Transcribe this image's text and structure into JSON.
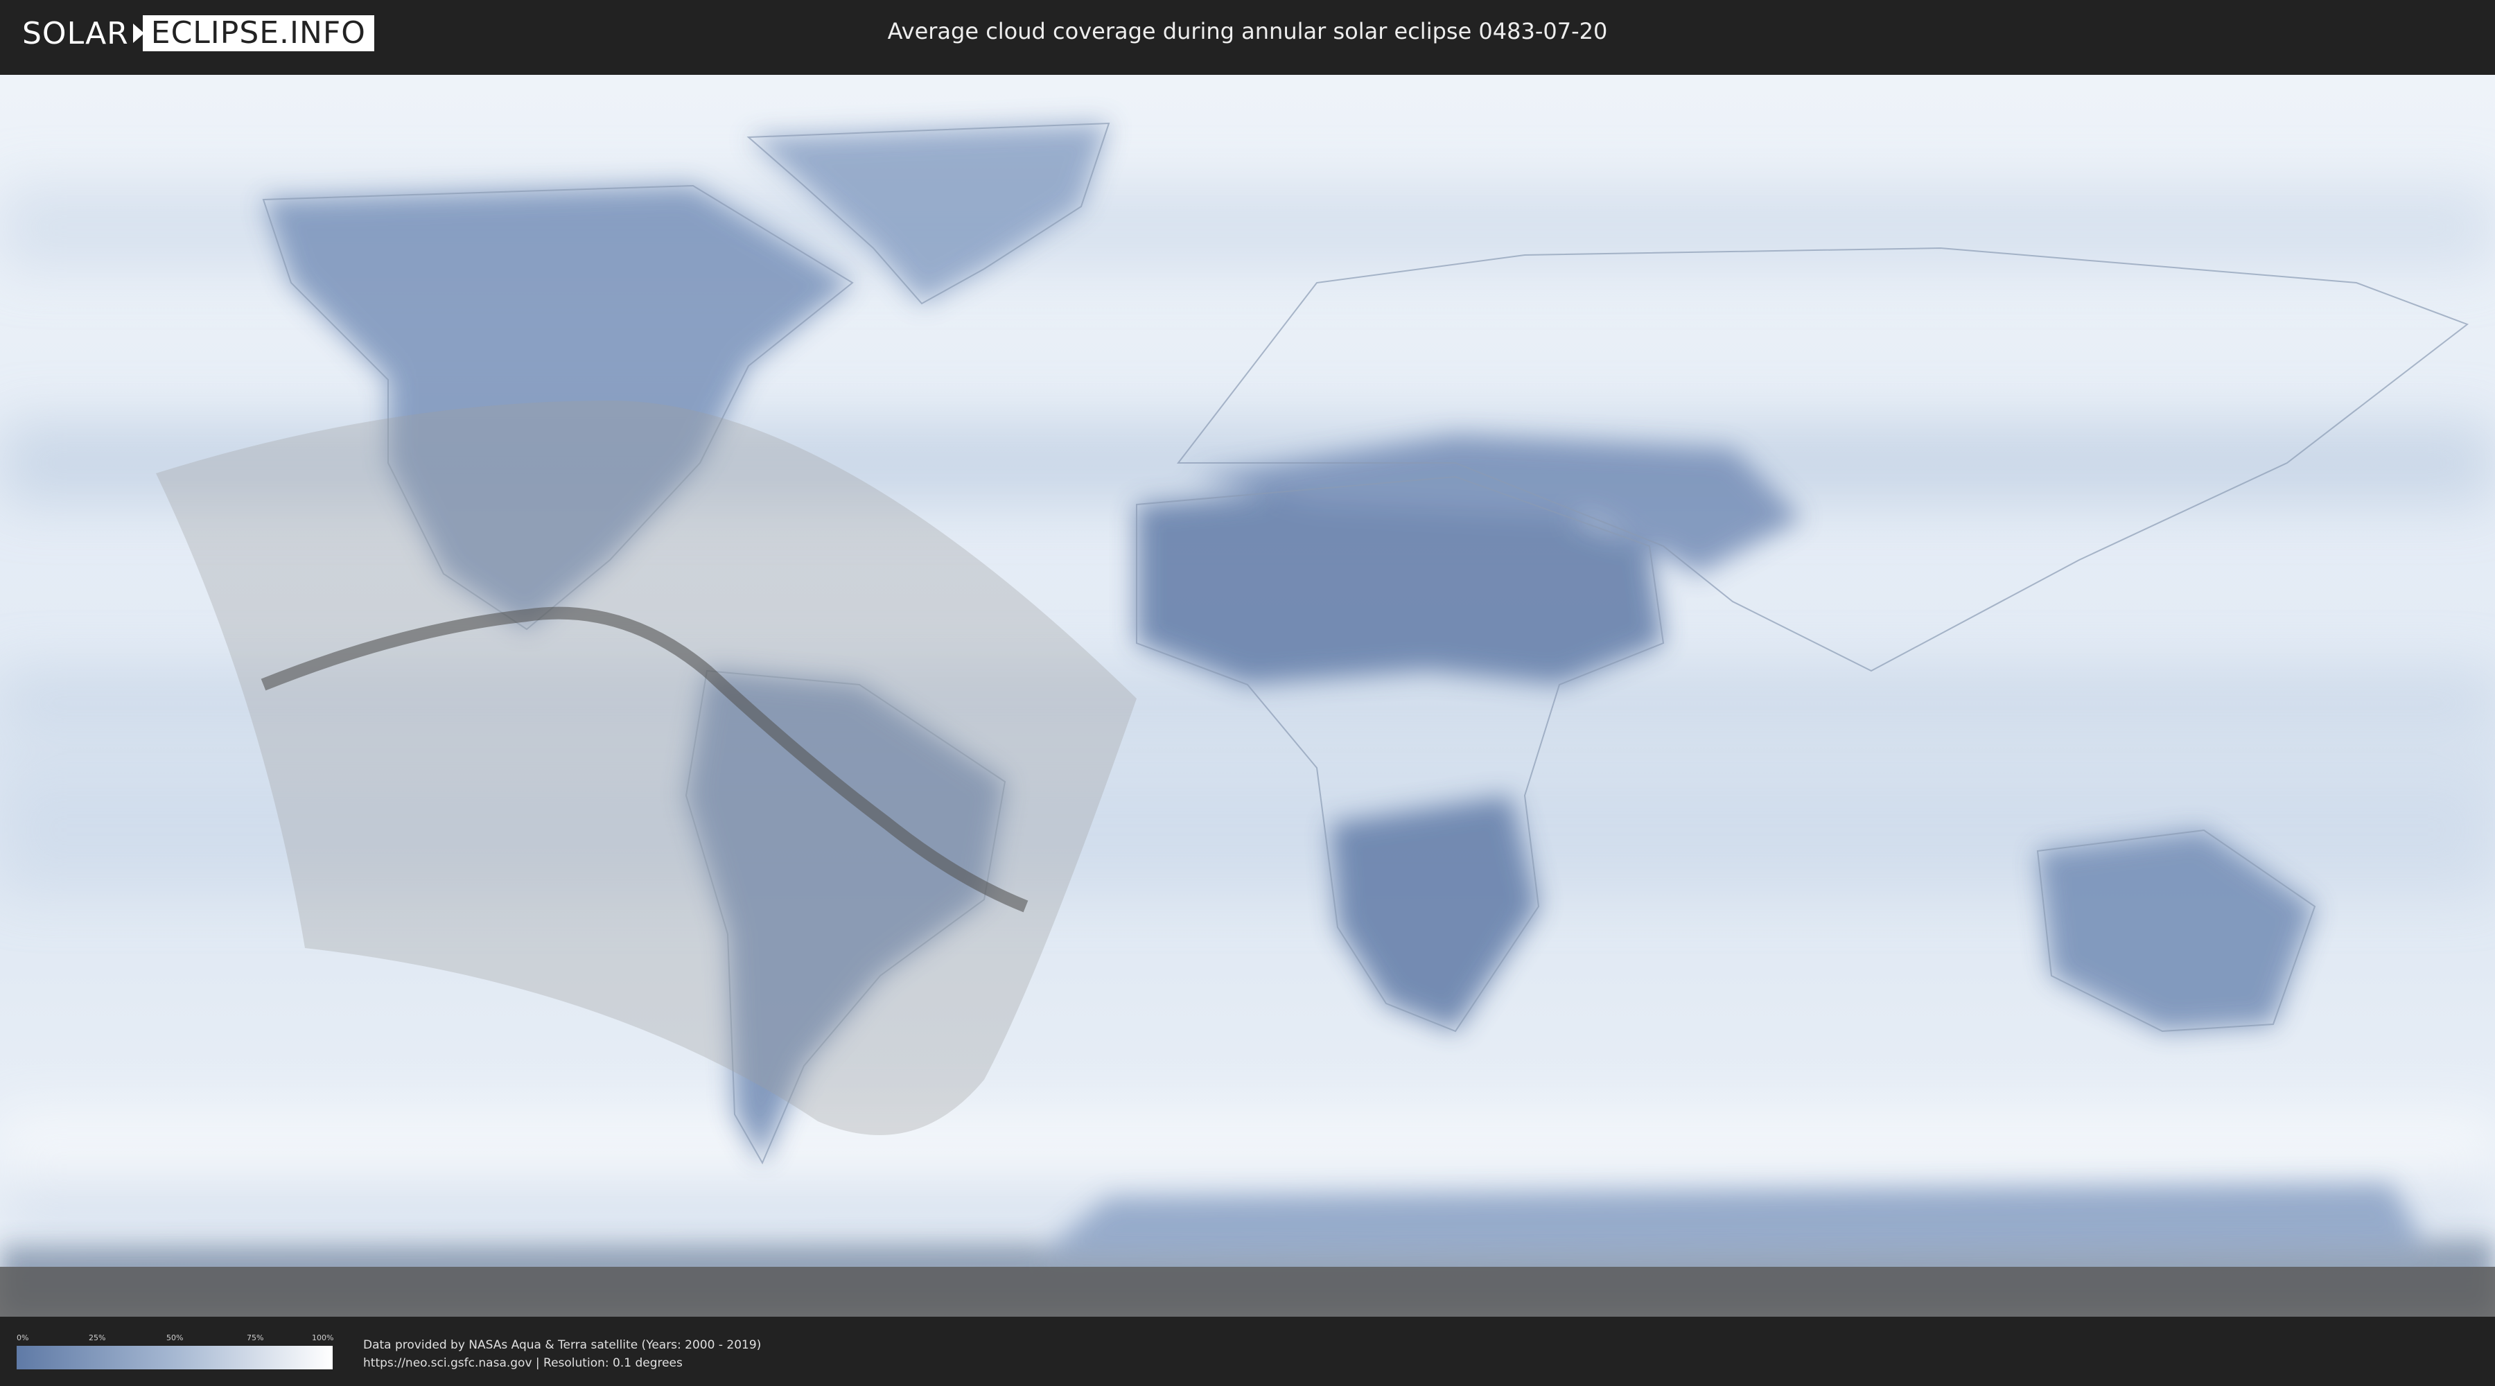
{
  "header": {
    "logo_left": "SOLAR",
    "logo_right": "ECLIPSE.INFO",
    "title": "Average cloud coverage during annular solar eclipse 0483-07-20"
  },
  "legend": {
    "labels": [
      "0%",
      "25%",
      "50%",
      "75%",
      "100%"
    ],
    "color_low": "#5f7aa6",
    "color_high": "#ffffff"
  },
  "footer": {
    "credit_line1": "Data provided by NASAs Aqua & Terra satellite (Years: 2000 - 2019)",
    "credit_line2": "https://neo.sci.gsfc.nasa.gov | Resolution: 0.1 degrees"
  },
  "map": {
    "ocean_color": "#f2f6fb",
    "land_cloud_color": "#5f7aa6",
    "eclipse_zone_color": "#9e9e9e",
    "central_path_color": "#555555"
  }
}
